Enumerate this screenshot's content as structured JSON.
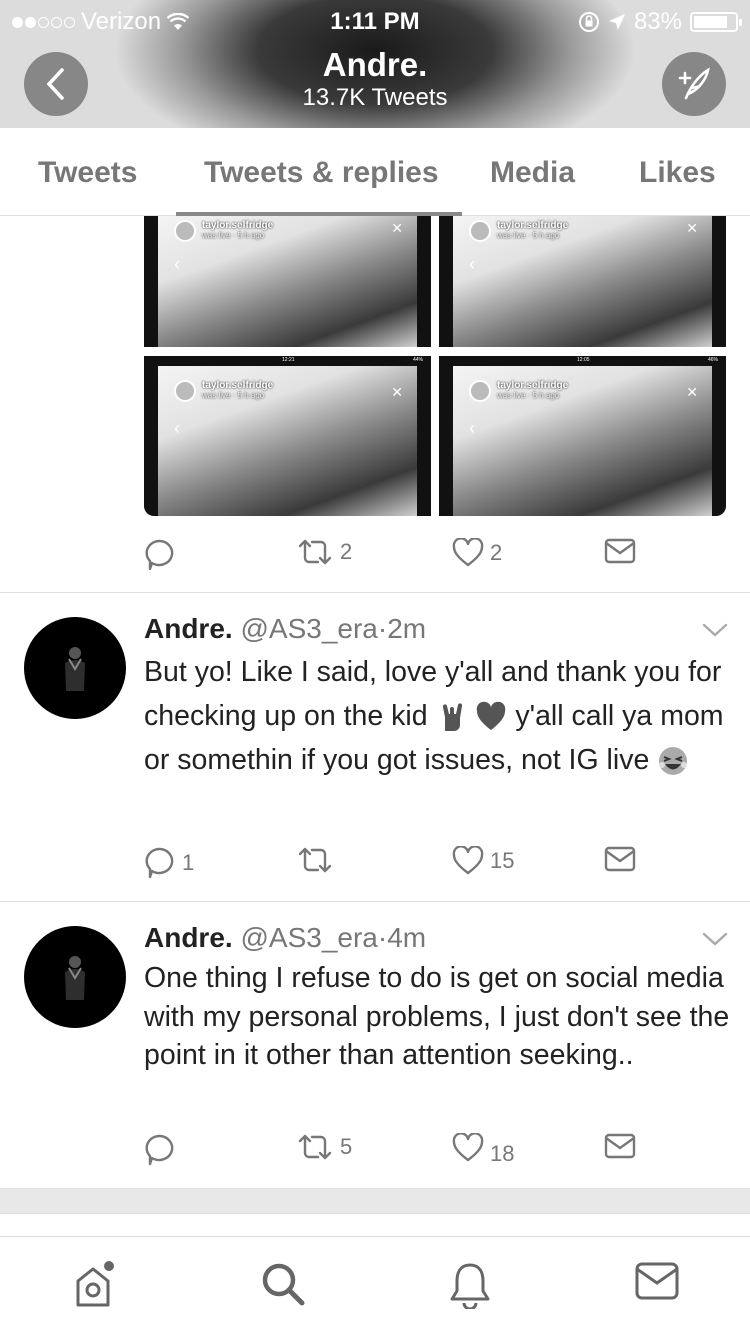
{
  "status_bar": {
    "carrier": "Verizon",
    "time": "1:11 PM",
    "battery": "83%",
    "battery_level": 0.83
  },
  "header": {
    "name": "Andre.",
    "tweet_count": "13.7K Tweets"
  },
  "tabs": [
    {
      "label": "Tweets"
    },
    {
      "label": "Tweets & replies"
    },
    {
      "label": "Media"
    },
    {
      "label": "Likes"
    }
  ],
  "media_grid": {
    "items": [
      {
        "username": "taylor.selfridge",
        "status": "was live · 5 h ago"
      },
      {
        "username": "taylor.selfridge",
        "status": "was live · 5 h ago"
      },
      {
        "username": "taylor.selfridge",
        "status": "was live · 5 h ago",
        "clock": "12:21",
        "battery": "44%"
      },
      {
        "username": "taylor.selfridge",
        "status": "was live · 5 h ago",
        "clock": "12:05",
        "battery": "46%"
      }
    ]
  },
  "tweet0_actions": {
    "replies": "",
    "retweets": "2",
    "likes": "2"
  },
  "tweets": [
    {
      "name": "Andre.",
      "handle": "@AS3_era",
      "time": "2m",
      "text_1": "But yo! Like I said, love y'all and thank you for checking up on the kid",
      "text_2": "y'all call ya mom or somethin if you got issues, not IG live",
      "replies": "1",
      "retweets": "",
      "likes": "15"
    },
    {
      "name": "Andre.",
      "handle": "@AS3_era",
      "time": "4m",
      "text": "One thing I refuse to do is get on social media with my personal problems, I just don't see the point in it other than attention seeking..",
      "replies": "",
      "retweets": "5",
      "likes": "18"
    }
  ],
  "tabbar": [
    {
      "icon": "home-icon"
    },
    {
      "icon": "search-icon"
    },
    {
      "icon": "bell-icon"
    },
    {
      "icon": "mail-icon"
    }
  ]
}
